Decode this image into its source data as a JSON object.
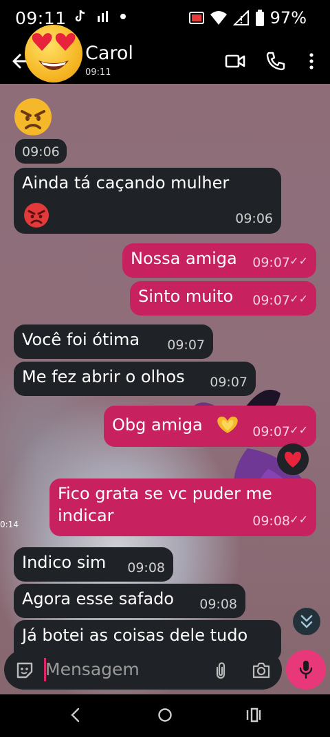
{
  "status": {
    "time": "09:11",
    "battery": "97%"
  },
  "header": {
    "contact_name": "Carol",
    "last_seen": "09:11"
  },
  "messages": [
    {
      "id": "m0",
      "direction": "in",
      "type": "emoji",
      "emoji": "angry-face",
      "time": "09:06"
    },
    {
      "id": "m1",
      "direction": "in",
      "text": "Ainda tá caçando mulher",
      "emoji": "pouting-face",
      "time": "09:06"
    },
    {
      "id": "m2",
      "direction": "out",
      "text": "Nossa amiga",
      "time": "09:07"
    },
    {
      "id": "m3",
      "direction": "out",
      "text": "Sinto muito",
      "time": "09:07"
    },
    {
      "id": "m4",
      "direction": "in",
      "text": "Você foi ótima",
      "time": "09:07"
    },
    {
      "id": "m5",
      "direction": "in",
      "text": "Me fez abrir o olhos",
      "time": "09:07"
    },
    {
      "id": "m6",
      "direction": "out",
      "text": "Obg amiga",
      "emoji": "heart-hands",
      "time": "09:07",
      "reaction": "red-heart"
    },
    {
      "id": "m7",
      "direction": "out",
      "text": "Fico grata se vc puder me indicar",
      "time": "09:08"
    },
    {
      "id": "m8",
      "direction": "in",
      "text": "Indico sim",
      "time": "09:08"
    },
    {
      "id": "m9",
      "direction": "in",
      "text": "Agora esse safado",
      "time": "09:08"
    },
    {
      "id": "m10",
      "direction": "in",
      "text": "Já botei as coisas dele tudo",
      "time": ""
    }
  ],
  "side_label": "0:14",
  "composer": {
    "placeholder": "Mensagem"
  },
  "colors": {
    "incoming_bubble": "#1f2226",
    "outgoing_bubble": "#c8215f",
    "mic_button": "#e8387a"
  }
}
